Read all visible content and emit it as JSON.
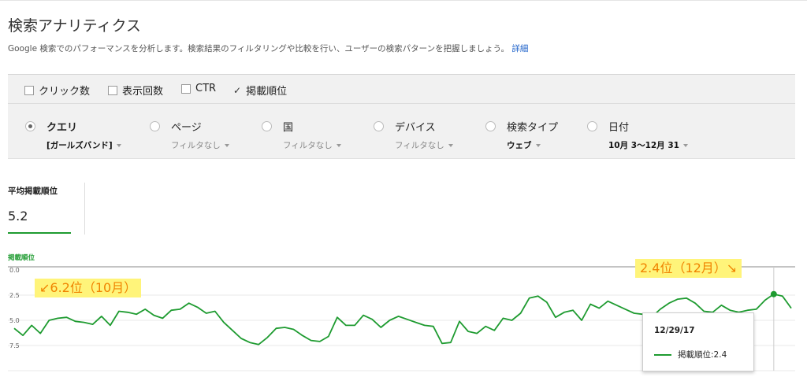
{
  "page": {
    "title": "検索アナリティクス",
    "description": "Google 検索でのパフォーマンスを分析します。検索結果のフィルタリングや比較を行い、ユーザーの検索パターンを把握しましょう。",
    "details_link": "詳細"
  },
  "metrics": [
    {
      "label": "クリック数",
      "checked": false
    },
    {
      "label": "表示回数",
      "checked": false
    },
    {
      "label": "CTR",
      "checked": false
    },
    {
      "label": "掲載順位",
      "checked": true
    }
  ],
  "dimensions": [
    {
      "label": "クエリ",
      "selected": true,
      "filter": "[ガールズバンド]",
      "filter_active": true
    },
    {
      "label": "ページ",
      "selected": false,
      "filter": "フィルタなし",
      "filter_active": false
    },
    {
      "label": "国",
      "selected": false,
      "filter": "フィルタなし",
      "filter_active": false
    },
    {
      "label": "デバイス",
      "selected": false,
      "filter": "フィルタなし",
      "filter_active": false
    },
    {
      "label": "検索タイプ",
      "selected": false,
      "filter": "ウェブ",
      "filter_active": true
    },
    {
      "label": "日付",
      "selected": false,
      "filter": "10月 3〜12月 31",
      "filter_active": true
    }
  ],
  "summary": {
    "label": "平均掲載順位",
    "value": "5.2"
  },
  "chart_data": {
    "type": "line",
    "title": "",
    "series_label": "掲載順位",
    "y_tick_labels": [
      "0.0",
      "2.5",
      "5.0",
      "7.5"
    ],
    "ylim": [
      0,
      10
    ],
    "y_inverted": true,
    "grid": true,
    "color": "#1e9b30",
    "series": [
      {
        "name": "掲載順位",
        "values": [
          5.8,
          6.5,
          5.5,
          6.3,
          5.0,
          4.8,
          4.7,
          5.1,
          5.2,
          5.4,
          4.6,
          5.5,
          4.1,
          4.2,
          4.4,
          3.9,
          4.5,
          4.8,
          4.0,
          3.9,
          3.3,
          3.7,
          4.3,
          4.1,
          5.2,
          6.0,
          6.8,
          7.2,
          7.4,
          6.7,
          5.8,
          5.7,
          5.9,
          6.5,
          7.0,
          7.1,
          6.6,
          4.7,
          5.5,
          5.5,
          4.5,
          4.9,
          5.7,
          5.0,
          4.6,
          4.9,
          5.2,
          5.5,
          5.6,
          7.3,
          7.2,
          5.1,
          6.1,
          6.3,
          5.6,
          6.0,
          4.8,
          5.0,
          4.3,
          2.8,
          2.6,
          3.2,
          4.7,
          4.2,
          4.0,
          5.0,
          3.4,
          3.8,
          3.1,
          3.5,
          3.9,
          4.3,
          4.4,
          4.7,
          3.9,
          3.3,
          2.9,
          2.8,
          3.3,
          4.1,
          4.2,
          3.5,
          4.0,
          4.2,
          4.0,
          3.9,
          3.0,
          2.4,
          2.6,
          3.8
        ]
      }
    ],
    "annotations": [
      "↙6.2位（10月）",
      "2.4位（12月）↘"
    ],
    "tooltip": {
      "date": "12/29/17",
      "label": "掲載順位",
      "value": "2.4"
    }
  }
}
